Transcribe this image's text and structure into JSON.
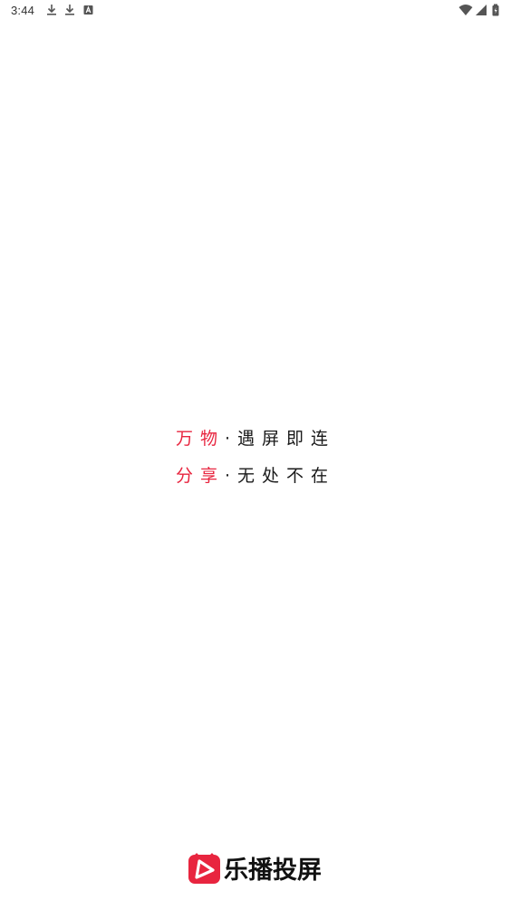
{
  "status_bar": {
    "time": "3:44",
    "left_icons": [
      "download-icon",
      "download-icon",
      "font-icon"
    ],
    "right_icons": [
      "wifi-icon",
      "signal-icon",
      "battery-icon"
    ]
  },
  "slogan": {
    "line1": {
      "accent": "万物",
      "separator": "·",
      "rest": "遇屏即连"
    },
    "line2": {
      "accent": "分享",
      "separator": "·",
      "rest": "无处不在"
    }
  },
  "brand": {
    "name": "乐播投屏",
    "logo_icon": "tv-play-icon"
  },
  "colors": {
    "accent": "#e8253f",
    "text": "#1a1a1a",
    "background": "#ffffff"
  }
}
